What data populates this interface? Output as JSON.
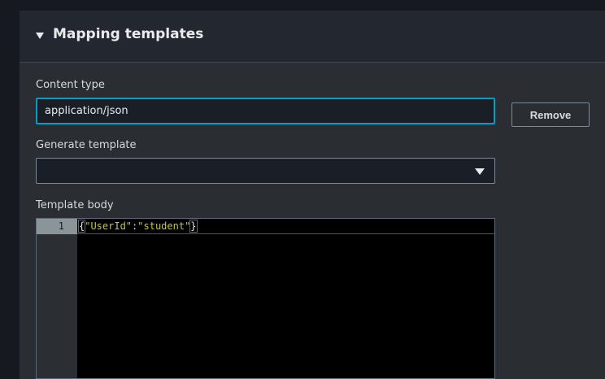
{
  "section": {
    "title": "Mapping templates"
  },
  "content_type": {
    "label": "Content type",
    "value": "application/json"
  },
  "remove_label": "Remove",
  "generate_template": {
    "label": "Generate template",
    "value": ""
  },
  "template_body": {
    "label": "Template body",
    "line_number": "1",
    "open_brace": "{",
    "key": "\"UserId\"",
    "colon": ":",
    "value": "\"student\"",
    "close_brace": "}"
  },
  "colors": {
    "focus": "#0a9cc4",
    "string": "#c2c83a"
  }
}
